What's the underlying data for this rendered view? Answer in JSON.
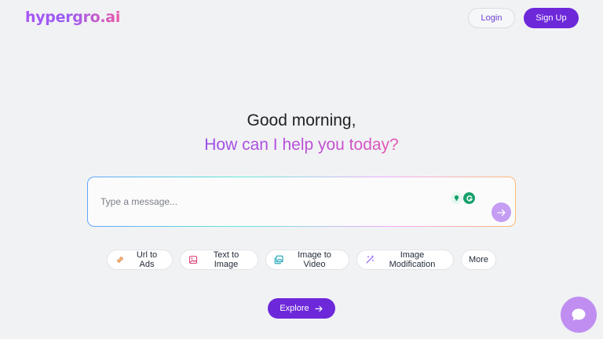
{
  "header": {
    "logo": "hypergro.ai",
    "login_label": "Login",
    "signup_label": "Sign Up"
  },
  "hero": {
    "greeting": "Good morning,",
    "subtitle": "How can I help you today?"
  },
  "composer": {
    "placeholder": "Type a message...",
    "value": ""
  },
  "actions": [
    {
      "label": "Url to Ads",
      "icon": "link-icon"
    },
    {
      "label": "Text to Image",
      "icon": "image-icon"
    },
    {
      "label": "Image to Video",
      "icon": "images-icon"
    },
    {
      "label": "Image Modification",
      "icon": "magic-wand-icon"
    },
    {
      "label": "More",
      "icon": ""
    }
  ],
  "explore": {
    "label": "Explore"
  },
  "colors": {
    "primary": "#6d28d9",
    "background": "#f1f2f4",
    "send_button": "#c59df3",
    "chat_bubble": "#c08ef0"
  }
}
